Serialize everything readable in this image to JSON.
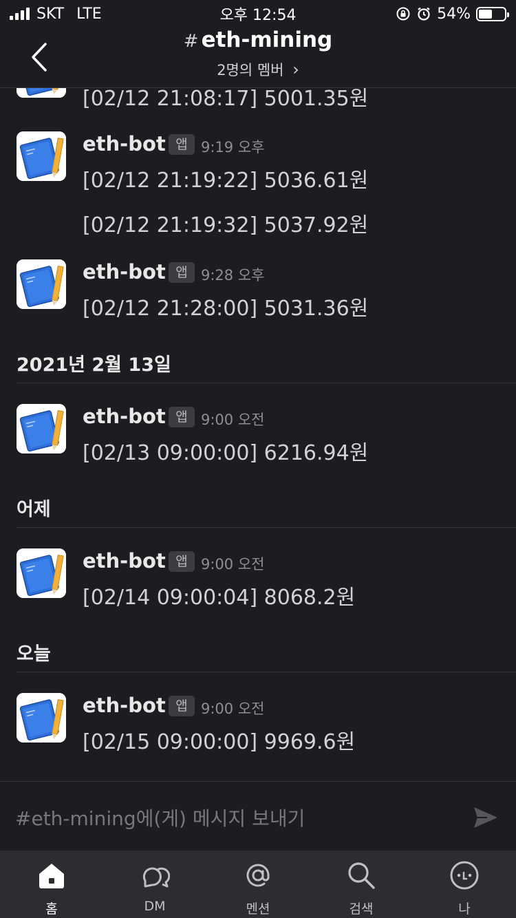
{
  "status_bar": {
    "carrier": "SKT",
    "network": "LTE",
    "time": "오후 12:54",
    "battery_text": "54%",
    "battery_level": 0.54
  },
  "header": {
    "hash": "#",
    "channel": "eth-mining",
    "members": "2명의 멤버",
    "members_chevron": "›"
  },
  "messages": {
    "partial": {
      "text": "[02/12 21:08:17] 5001.35원"
    },
    "m1": {
      "sender": "eth-bot",
      "badge": "앱",
      "time": "9:19 오후",
      "lines": [
        "[02/12 21:19:22] 5036.61원",
        "[02/12 21:19:32] 5037.92원"
      ]
    },
    "m2": {
      "sender": "eth-bot",
      "badge": "앱",
      "time": "9:28 오후",
      "lines": [
        "[02/12 21:28:00] 5031.36원"
      ]
    },
    "m3": {
      "sender": "eth-bot",
      "badge": "앱",
      "time": "9:00 오전",
      "lines": [
        "[02/13 09:00:00] 6216.94원"
      ]
    },
    "m4": {
      "sender": "eth-bot",
      "badge": "앱",
      "time": "9:00 오전",
      "lines": [
        "[02/14 09:00:04] 8068.2원"
      ]
    },
    "m5": {
      "sender": "eth-bot",
      "badge": "앱",
      "time": "9:00 오전",
      "lines": [
        "[02/15 09:00:00] 9969.6원"
      ]
    }
  },
  "dividers": {
    "d1": "2021년 2월 13일",
    "d2": "어제",
    "d3": "오늘"
  },
  "composer": {
    "placeholder": "#eth-mining에(게) 메시지 보내기"
  },
  "tabs": [
    {
      "label": "홈",
      "icon": "home-icon",
      "active": true
    },
    {
      "label": "DM",
      "icon": "dm-icon",
      "active": false
    },
    {
      "label": "멘션",
      "icon": "mention-icon",
      "active": false
    },
    {
      "label": "검색",
      "icon": "search-icon",
      "active": false
    },
    {
      "label": "나",
      "icon": "profile-icon",
      "active": false
    }
  ]
}
